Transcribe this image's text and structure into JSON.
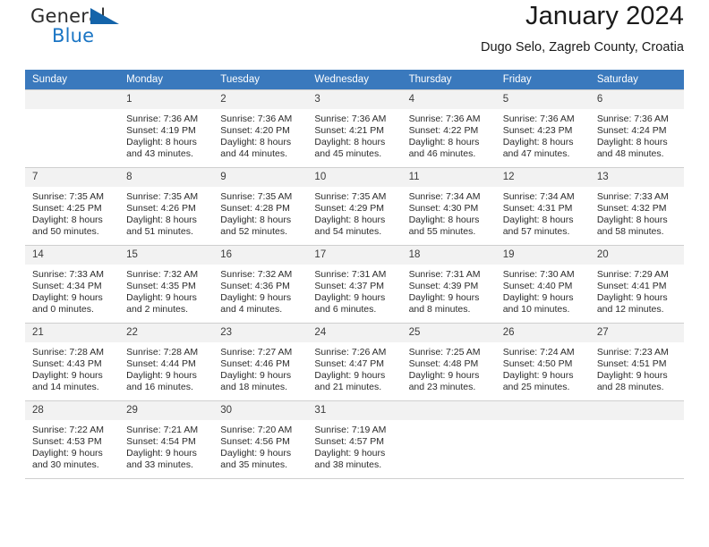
{
  "brand": {
    "name_part1": "General",
    "name_part2": "Blue",
    "triangle_color": "#1464aa",
    "blue_color": "#1a75c4"
  },
  "header": {
    "title": "January 2024",
    "subtitle": "Dugo Selo, Zagreb County, Croatia"
  },
  "calendar": {
    "header_bg": "#3a79bd",
    "daynum_bg": "#f2f2f2",
    "weekdays": [
      "Sunday",
      "Monday",
      "Tuesday",
      "Wednesday",
      "Thursday",
      "Friday",
      "Saturday"
    ],
    "weeks": [
      [
        {
          "day": "",
          "empty": true,
          "sunrise": "",
          "sunset": "",
          "daylight1": "",
          "daylight2": ""
        },
        {
          "day": "1",
          "sunrise": "Sunrise: 7:36 AM",
          "sunset": "Sunset: 4:19 PM",
          "daylight1": "Daylight: 8 hours",
          "daylight2": "and 43 minutes."
        },
        {
          "day": "2",
          "sunrise": "Sunrise: 7:36 AM",
          "sunset": "Sunset: 4:20 PM",
          "daylight1": "Daylight: 8 hours",
          "daylight2": "and 44 minutes."
        },
        {
          "day": "3",
          "sunrise": "Sunrise: 7:36 AM",
          "sunset": "Sunset: 4:21 PM",
          "daylight1": "Daylight: 8 hours",
          "daylight2": "and 45 minutes."
        },
        {
          "day": "4",
          "sunrise": "Sunrise: 7:36 AM",
          "sunset": "Sunset: 4:22 PM",
          "daylight1": "Daylight: 8 hours",
          "daylight2": "and 46 minutes."
        },
        {
          "day": "5",
          "sunrise": "Sunrise: 7:36 AM",
          "sunset": "Sunset: 4:23 PM",
          "daylight1": "Daylight: 8 hours",
          "daylight2": "and 47 minutes."
        },
        {
          "day": "6",
          "sunrise": "Sunrise: 7:36 AM",
          "sunset": "Sunset: 4:24 PM",
          "daylight1": "Daylight: 8 hours",
          "daylight2": "and 48 minutes."
        }
      ],
      [
        {
          "day": "7",
          "sunrise": "Sunrise: 7:35 AM",
          "sunset": "Sunset: 4:25 PM",
          "daylight1": "Daylight: 8 hours",
          "daylight2": "and 50 minutes."
        },
        {
          "day": "8",
          "sunrise": "Sunrise: 7:35 AM",
          "sunset": "Sunset: 4:26 PM",
          "daylight1": "Daylight: 8 hours",
          "daylight2": "and 51 minutes."
        },
        {
          "day": "9",
          "sunrise": "Sunrise: 7:35 AM",
          "sunset": "Sunset: 4:28 PM",
          "daylight1": "Daylight: 8 hours",
          "daylight2": "and 52 minutes."
        },
        {
          "day": "10",
          "sunrise": "Sunrise: 7:35 AM",
          "sunset": "Sunset: 4:29 PM",
          "daylight1": "Daylight: 8 hours",
          "daylight2": "and 54 minutes."
        },
        {
          "day": "11",
          "sunrise": "Sunrise: 7:34 AM",
          "sunset": "Sunset: 4:30 PM",
          "daylight1": "Daylight: 8 hours",
          "daylight2": "and 55 minutes."
        },
        {
          "day": "12",
          "sunrise": "Sunrise: 7:34 AM",
          "sunset": "Sunset: 4:31 PM",
          "daylight1": "Daylight: 8 hours",
          "daylight2": "and 57 minutes."
        },
        {
          "day": "13",
          "sunrise": "Sunrise: 7:33 AM",
          "sunset": "Sunset: 4:32 PM",
          "daylight1": "Daylight: 8 hours",
          "daylight2": "and 58 minutes."
        }
      ],
      [
        {
          "day": "14",
          "sunrise": "Sunrise: 7:33 AM",
          "sunset": "Sunset: 4:34 PM",
          "daylight1": "Daylight: 9 hours",
          "daylight2": "and 0 minutes."
        },
        {
          "day": "15",
          "sunrise": "Sunrise: 7:32 AM",
          "sunset": "Sunset: 4:35 PM",
          "daylight1": "Daylight: 9 hours",
          "daylight2": "and 2 minutes."
        },
        {
          "day": "16",
          "sunrise": "Sunrise: 7:32 AM",
          "sunset": "Sunset: 4:36 PM",
          "daylight1": "Daylight: 9 hours",
          "daylight2": "and 4 minutes."
        },
        {
          "day": "17",
          "sunrise": "Sunrise: 7:31 AM",
          "sunset": "Sunset: 4:37 PM",
          "daylight1": "Daylight: 9 hours",
          "daylight2": "and 6 minutes."
        },
        {
          "day": "18",
          "sunrise": "Sunrise: 7:31 AM",
          "sunset": "Sunset: 4:39 PM",
          "daylight1": "Daylight: 9 hours",
          "daylight2": "and 8 minutes."
        },
        {
          "day": "19",
          "sunrise": "Sunrise: 7:30 AM",
          "sunset": "Sunset: 4:40 PM",
          "daylight1": "Daylight: 9 hours",
          "daylight2": "and 10 minutes."
        },
        {
          "day": "20",
          "sunrise": "Sunrise: 7:29 AM",
          "sunset": "Sunset: 4:41 PM",
          "daylight1": "Daylight: 9 hours",
          "daylight2": "and 12 minutes."
        }
      ],
      [
        {
          "day": "21",
          "sunrise": "Sunrise: 7:28 AM",
          "sunset": "Sunset: 4:43 PM",
          "daylight1": "Daylight: 9 hours",
          "daylight2": "and 14 minutes."
        },
        {
          "day": "22",
          "sunrise": "Sunrise: 7:28 AM",
          "sunset": "Sunset: 4:44 PM",
          "daylight1": "Daylight: 9 hours",
          "daylight2": "and 16 minutes."
        },
        {
          "day": "23",
          "sunrise": "Sunrise: 7:27 AM",
          "sunset": "Sunset: 4:46 PM",
          "daylight1": "Daylight: 9 hours",
          "daylight2": "and 18 minutes."
        },
        {
          "day": "24",
          "sunrise": "Sunrise: 7:26 AM",
          "sunset": "Sunset: 4:47 PM",
          "daylight1": "Daylight: 9 hours",
          "daylight2": "and 21 minutes."
        },
        {
          "day": "25",
          "sunrise": "Sunrise: 7:25 AM",
          "sunset": "Sunset: 4:48 PM",
          "daylight1": "Daylight: 9 hours",
          "daylight2": "and 23 minutes."
        },
        {
          "day": "26",
          "sunrise": "Sunrise: 7:24 AM",
          "sunset": "Sunset: 4:50 PM",
          "daylight1": "Daylight: 9 hours",
          "daylight2": "and 25 minutes."
        },
        {
          "day": "27",
          "sunrise": "Sunrise: 7:23 AM",
          "sunset": "Sunset: 4:51 PM",
          "daylight1": "Daylight: 9 hours",
          "daylight2": "and 28 minutes."
        }
      ],
      [
        {
          "day": "28",
          "sunrise": "Sunrise: 7:22 AM",
          "sunset": "Sunset: 4:53 PM",
          "daylight1": "Daylight: 9 hours",
          "daylight2": "and 30 minutes."
        },
        {
          "day": "29",
          "sunrise": "Sunrise: 7:21 AM",
          "sunset": "Sunset: 4:54 PM",
          "daylight1": "Daylight: 9 hours",
          "daylight2": "and 33 minutes."
        },
        {
          "day": "30",
          "sunrise": "Sunrise: 7:20 AM",
          "sunset": "Sunset: 4:56 PM",
          "daylight1": "Daylight: 9 hours",
          "daylight2": "and 35 minutes."
        },
        {
          "day": "31",
          "sunrise": "Sunrise: 7:19 AM",
          "sunset": "Sunset: 4:57 PM",
          "daylight1": "Daylight: 9 hours",
          "daylight2": "and 38 minutes."
        },
        {
          "day": "",
          "empty": true,
          "sunrise": "",
          "sunset": "",
          "daylight1": "",
          "daylight2": ""
        },
        {
          "day": "",
          "empty": true,
          "sunrise": "",
          "sunset": "",
          "daylight1": "",
          "daylight2": ""
        },
        {
          "day": "",
          "empty": true,
          "sunrise": "",
          "sunset": "",
          "daylight1": "",
          "daylight2": ""
        }
      ]
    ]
  }
}
